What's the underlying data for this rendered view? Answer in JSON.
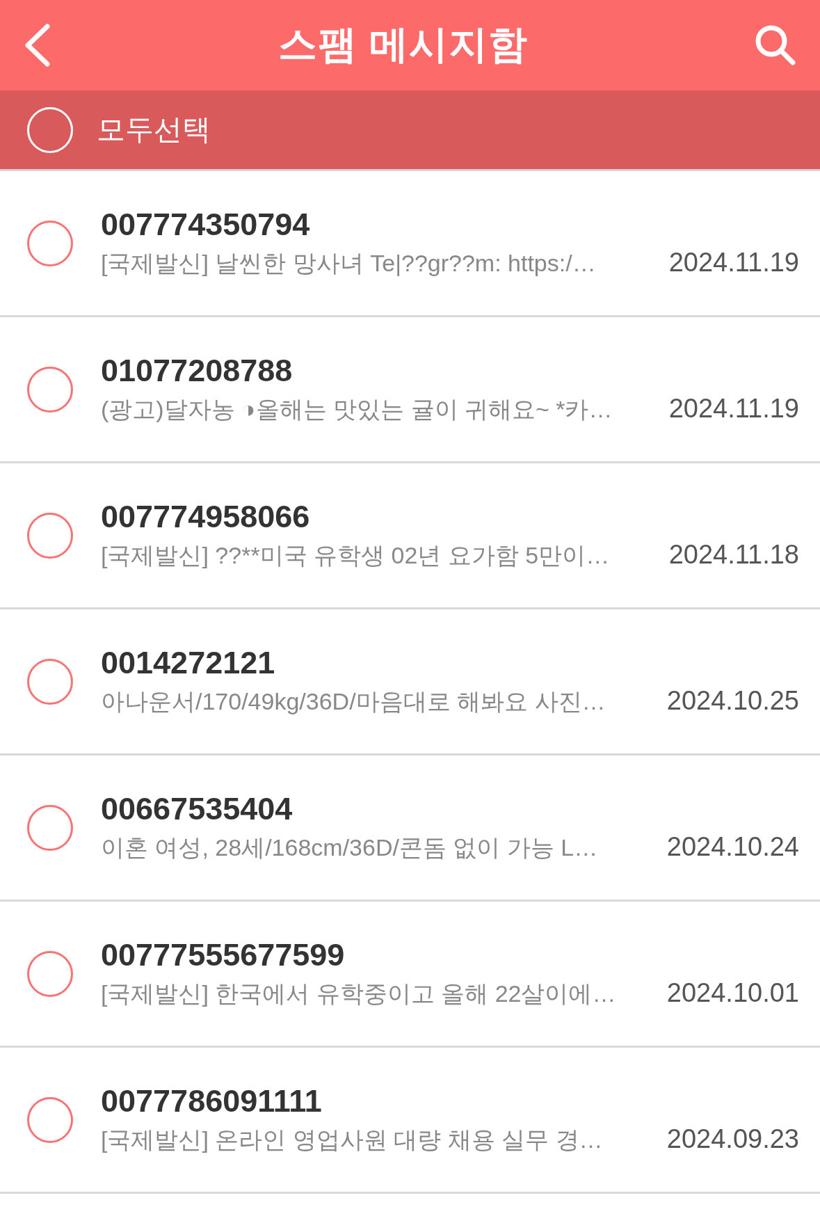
{
  "header": {
    "title": "스팸 메시지함"
  },
  "select_all": {
    "label": "모두선택",
    "checked": false
  },
  "messages": [
    {
      "sender": "007774350794",
      "preview": "[국제발신] 날씬한 망사녀 Te|??gr??m: https:/…",
      "date": "2024.11.19",
      "checked": false
    },
    {
      "sender": "01077208788",
      "preview": "(광고)달자농 ◑올해는 맛있는 귤이 귀해요~ *카…",
      "date": "2024.11.19",
      "checked": false
    },
    {
      "sender": "007774958066",
      "preview": "[국제발신] ??**미국 유학생 02년 요가함 5만이…",
      "date": "2024.11.18",
      "checked": false
    },
    {
      "sender": "0014272121",
      "preview": "아나운서/170/49kg/36D/마음대로 해봐요 사진…",
      "date": "2024.10.25",
      "checked": false
    },
    {
      "sender": "00667535404",
      "preview": "이혼 여성, 28세/168cm/36D/콘돔 없이 가능 L…",
      "date": "2024.10.24",
      "checked": false
    },
    {
      "sender": "00777555677599",
      "preview": "[국제발신] 한국에서 유학중이고 올해 22살이에…",
      "date": "2024.10.01",
      "checked": false
    },
    {
      "sender": "0077786091111",
      "preview": "[국제발신] 온라인 영업사원 대량 채용 실무 경…",
      "date": "2024.09.23",
      "checked": false
    }
  ]
}
